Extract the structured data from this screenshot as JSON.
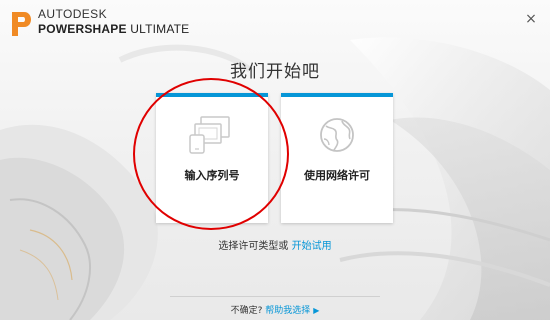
{
  "header": {
    "brand_line1": "AUTODESK",
    "brand_line2_strong": "POWERSHAPE",
    "brand_line2_rest": " ULTIMATE",
    "close_label": "×"
  },
  "title": "我们开始吧",
  "options": [
    {
      "label": "输入序列号",
      "icon": "devices-icon"
    },
    {
      "label": "使用网络许可",
      "icon": "globe-icon"
    }
  ],
  "license_prompt": "选择许可类型或",
  "trial_link": "开始试用",
  "footer": {
    "unsure_text": "不确定?",
    "help_link": "帮助我选择",
    "help_arrow": "▶"
  },
  "colors": {
    "accent": "#0696d7",
    "logo": "#f08a24",
    "highlight_circle": "#e00000"
  }
}
